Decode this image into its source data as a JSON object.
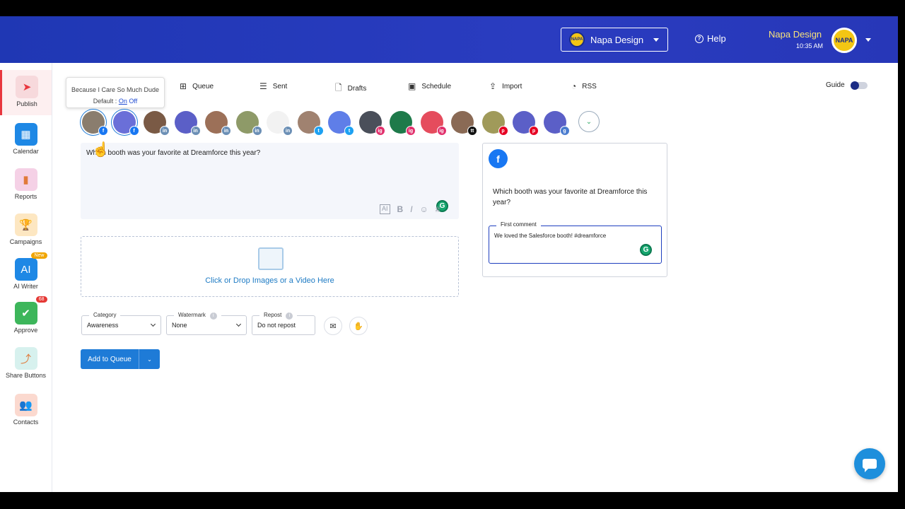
{
  "header": {
    "workspace": {
      "name": "Napa Design",
      "logo_text": "NAPA"
    },
    "help_label": "Help",
    "user": {
      "name": "Napa Design",
      "time": "10:35 AM",
      "avatar_text": "NAPA"
    }
  },
  "sidebar": {
    "items": [
      {
        "label": "Publish",
        "icon": "paper-plane-icon",
        "color": "#f7d9dc",
        "glyph": "➤",
        "active": true
      },
      {
        "label": "Calendar",
        "icon": "calendar-icon",
        "color": "#1e88e5",
        "glyph": "▦"
      },
      {
        "label": "Reports",
        "icon": "bar-chart-icon",
        "color": "#f5d1e6",
        "glyph": "▮"
      },
      {
        "label": "Campaigns",
        "icon": "trophy-icon",
        "color": "#fde7c2",
        "glyph": "🏆"
      },
      {
        "label": "AI Writer",
        "icon": "ai-pencil-icon",
        "color": "#1e88e5",
        "glyph": "AI",
        "badge": "New",
        "badge_color": "#f0a500"
      },
      {
        "label": "Approve",
        "icon": "image-check-icon",
        "color": "#3db65b",
        "glyph": "✔",
        "badge": "68",
        "badge_color": "#e53935"
      },
      {
        "label": "Share Buttons",
        "icon": "share-icon",
        "color": "#d7f1ee",
        "glyph": "⤴"
      },
      {
        "label": "Contacts",
        "icon": "people-icon",
        "color": "#fbd9cf",
        "glyph": "👥"
      }
    ]
  },
  "tooltip": {
    "title": "Because I Care So Much Dude",
    "default_label": "Default :",
    "on": "On",
    "off": "Off"
  },
  "tabs": [
    {
      "label": "Queue",
      "icon": "plus-square-icon",
      "glyph": "⊞"
    },
    {
      "label": "Sent",
      "icon": "list-icon",
      "glyph": "☰"
    },
    {
      "label": "Drafts",
      "icon": "file-icon",
      "glyph": "🗋"
    },
    {
      "label": "Schedule",
      "icon": "calendar-plus-icon",
      "glyph": "▣"
    },
    {
      "label": "Import",
      "icon": "import-icon",
      "glyph": "⇪"
    },
    {
      "label": "RSS",
      "icon": "rss-icon",
      "glyph": "◔"
    }
  ],
  "guide": {
    "label": "Guide"
  },
  "accounts": [
    {
      "network": "facebook",
      "badge": "f",
      "badge_color": "#1877f2",
      "bg": "#8a7d6e",
      "selected": true
    },
    {
      "network": "facebook",
      "badge": "f",
      "badge_color": "#1877f2",
      "bg": "#6a6fd8",
      "selected": true
    },
    {
      "network": "linkedin",
      "badge": "in",
      "badge_color": "#6b8fb5",
      "bg": "#7a5a45"
    },
    {
      "network": "linkedin",
      "badge": "in",
      "badge_color": "#6b8fb5",
      "bg": "#5b5fc7"
    },
    {
      "network": "linkedin",
      "badge": "in",
      "badge_color": "#6b8fb5",
      "bg": "#9c7058"
    },
    {
      "network": "linkedin",
      "badge": "in",
      "badge_color": "#6b8fb5",
      "bg": "#8e9a68"
    },
    {
      "network": "linkedin",
      "badge": "in",
      "badge_color": "#6b8fb5",
      "bg": "#f2f2f2"
    },
    {
      "network": "twitter",
      "badge": "t",
      "badge_color": "#1da1f2",
      "bg": "#a08270"
    },
    {
      "network": "twitter",
      "badge": "t",
      "badge_color": "#1da1f2",
      "bg": "#5f7ee8"
    },
    {
      "network": "instagram",
      "badge": "ig",
      "badge_color": "#e1306c",
      "bg": "#4a4f5a"
    },
    {
      "network": "instagram",
      "badge": "ig",
      "badge_color": "#e1306c",
      "bg": "#1e7a4a"
    },
    {
      "network": "instagram",
      "badge": "ig",
      "badge_color": "#e1306c",
      "bg": "#e54c5d"
    },
    {
      "network": "tiktok",
      "badge": "tt",
      "badge_color": "#111111",
      "bg": "#8a6a55"
    },
    {
      "network": "pinterest",
      "badge": "p",
      "badge_color": "#e60023",
      "bg": "#a09a5a"
    },
    {
      "network": "pinterest",
      "badge": "p",
      "badge_color": "#e60023",
      "bg": "#5b5fc7"
    },
    {
      "network": "google-business",
      "badge": "g",
      "badge_color": "#4a7ccf",
      "bg": "#5b5fc7"
    }
  ],
  "composer": {
    "text": "Which booth was your favorite at Dreamforce this year?",
    "tools": [
      "AI",
      "B",
      "I",
      "☺",
      "#"
    ]
  },
  "dropzone": {
    "text": "Click or Drop Images or a Video Here"
  },
  "options": {
    "category": {
      "label": "Category",
      "value": "Awareness"
    },
    "watermark": {
      "label": "Watermark",
      "value": "None"
    },
    "repost": {
      "label": "Repost",
      "value": "Do not repost"
    }
  },
  "queue_button": {
    "label": "Add to Queue"
  },
  "preview": {
    "network_badge": "f",
    "text": "Which booth was your favorite at Dreamforce this year?",
    "comment_label": "First comment",
    "comment_text": "We loved the Salesforce booth! #dreamforce"
  },
  "grammarly_glyph": "G"
}
